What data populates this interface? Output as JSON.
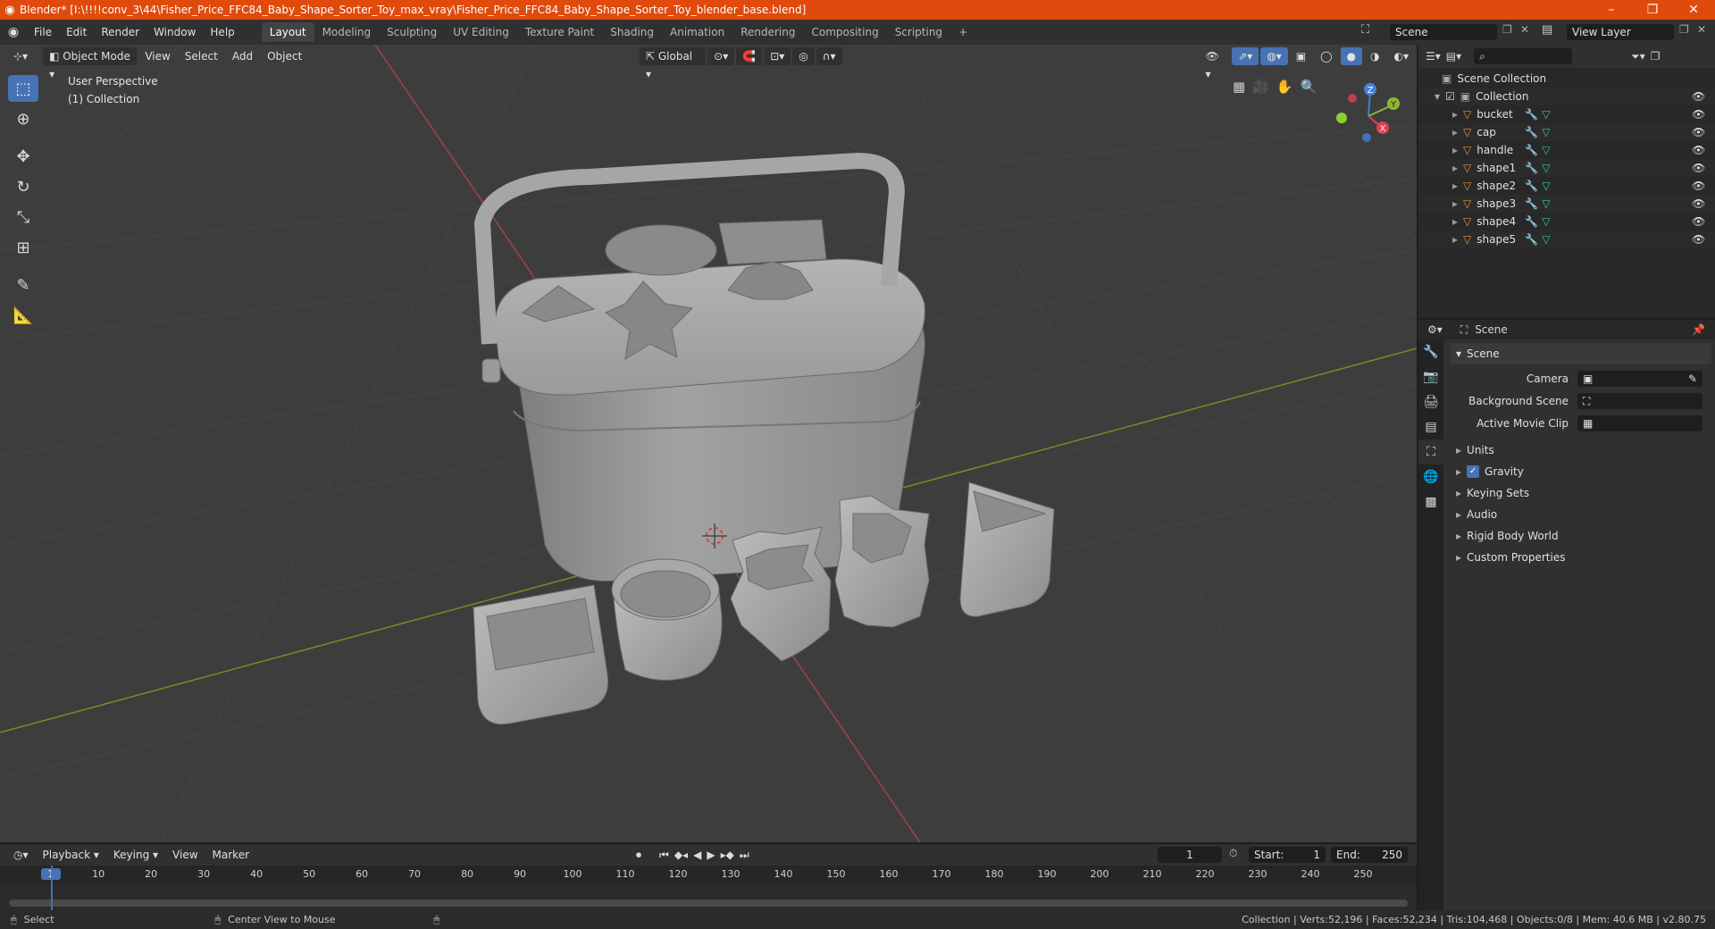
{
  "titlebar": {
    "title": "Blender* [I:\\!!!!conv_3\\44\\Fisher_Price_FFC84_Baby_Shape_Sorter_Toy_max_vray\\Fisher_Price_FFC84_Baby_Shape_Sorter_Toy_blender_base.blend]",
    "minimize": "–",
    "restore": "❐",
    "close": "✕"
  },
  "menu": [
    "File",
    "Edit",
    "Render",
    "Window",
    "Help"
  ],
  "workspaces": [
    "Layout",
    "Modeling",
    "Sculpting",
    "UV Editing",
    "Texture Paint",
    "Shading",
    "Animation",
    "Rendering",
    "Compositing",
    "Scripting"
  ],
  "workspace_add": "+",
  "scene_field": "Scene",
  "view_layer_field": "View Layer",
  "viewport": {
    "mode": "Object Mode",
    "menus": [
      "View",
      "Select",
      "Add",
      "Object"
    ],
    "transform": "Global",
    "perspective_label": "User Perspective",
    "collection_label": "(1) Collection",
    "gizmo": {
      "x": "X",
      "y": "Y",
      "z": "Z"
    }
  },
  "outliner": {
    "scene_collection": "Scene Collection",
    "collection": "Collection",
    "items": [
      "bucket",
      "cap",
      "handle",
      "shape1",
      "shape2",
      "shape3",
      "shape4",
      "shape5"
    ]
  },
  "properties": {
    "header": "Scene",
    "panel": "Scene",
    "camera_label": "Camera",
    "background_scene_label": "Background Scene",
    "active_movie_clip_label": "Active Movie Clip",
    "sections": [
      "Units",
      "Gravity",
      "Keying Sets",
      "Audio",
      "Rigid Body World",
      "Custom Properties"
    ]
  },
  "timeline": {
    "menus": [
      "Playback",
      "Keying",
      "View",
      "Marker"
    ],
    "current_frame": "1",
    "start_label": "Start:",
    "start": "1",
    "end_label": "End:",
    "end": "250",
    "ruler": [
      "1",
      "10",
      "20",
      "30",
      "40",
      "50",
      "60",
      "70",
      "80",
      "90",
      "100",
      "110",
      "120",
      "130",
      "140",
      "150",
      "160",
      "170",
      "180",
      "190",
      "200",
      "210",
      "220",
      "230",
      "240",
      "250"
    ]
  },
  "statusbar": {
    "select": "Select",
    "center_view": "Center View to Mouse",
    "stats": "Collection | Verts:52,196 | Faces:52,234 | Tris:104,468 | Objects:0/8 | Mem: 40.6 MB | v2.80.75"
  },
  "colors": {
    "accent": "#4772b3",
    "titlebar": "#e04a0c",
    "mesh_icon": "#e8903a",
    "modifier_icon": "#6aa8ff",
    "data_icon": "#34c8a0"
  }
}
